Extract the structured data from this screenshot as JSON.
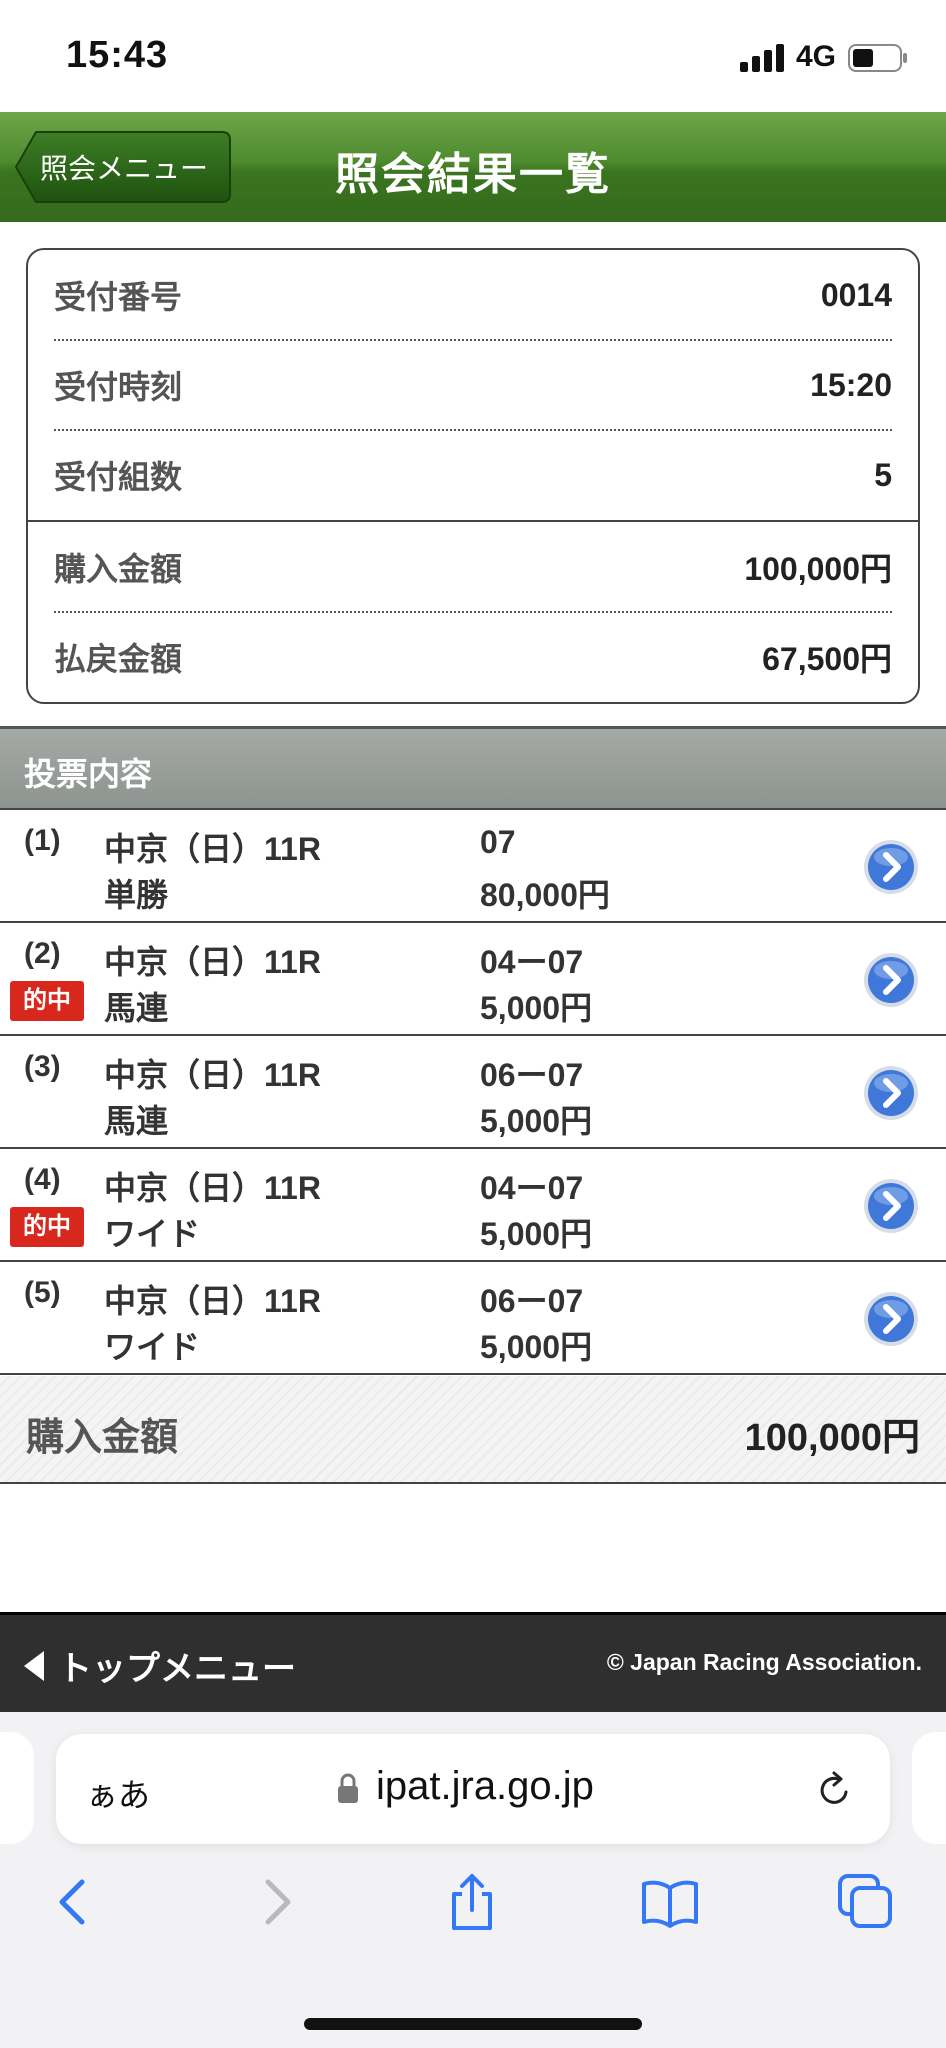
{
  "status_bar": {
    "time": "15:43",
    "network": "4G"
  },
  "header": {
    "back_label": "照会メニュー",
    "title": "照会結果一覧"
  },
  "summary": {
    "rows": [
      {
        "label": "受付番号",
        "value": "0014"
      },
      {
        "label": "受付時刻",
        "value": "15:20"
      },
      {
        "label": "受付組数",
        "value": "5"
      },
      {
        "label": "購入金額",
        "value": "100,000円"
      },
      {
        "label": "払戻金額",
        "value": "67,500円"
      }
    ]
  },
  "bets_section": {
    "title": "投票内容",
    "hit_badge": "的中",
    "items": [
      {
        "num": "(1)",
        "race": "中京（日）11R",
        "type": "単勝",
        "combo": "07",
        "amount": "80,000円",
        "hit": false
      },
      {
        "num": "(2)",
        "race": "中京（日）11R",
        "type": "馬連",
        "combo": "04ー07",
        "amount": "5,000円",
        "hit": true
      },
      {
        "num": "(3)",
        "race": "中京（日）11R",
        "type": "馬連",
        "combo": "06ー07",
        "amount": "5,000円",
        "hit": false
      },
      {
        "num": "(4)",
        "race": "中京（日）11R",
        "type": "ワイド",
        "combo": "04ー07",
        "amount": "5,000円",
        "hit": true
      },
      {
        "num": "(5)",
        "race": "中京（日）11R",
        "type": "ワイド",
        "combo": "06ー07",
        "amount": "5,000円",
        "hit": false
      }
    ]
  },
  "total": {
    "label": "購入金額",
    "value": "100,000円"
  },
  "footer": {
    "top_menu": "トップメニュー",
    "copyright": "© Japan Racing Association."
  },
  "browser": {
    "aa_label": "ぁあ",
    "host": "ipat.jra.go.jp"
  },
  "colors": {
    "header_green": "#3a7420",
    "hit_red": "#d8271c",
    "arrow_blue": "#3f78d8"
  }
}
